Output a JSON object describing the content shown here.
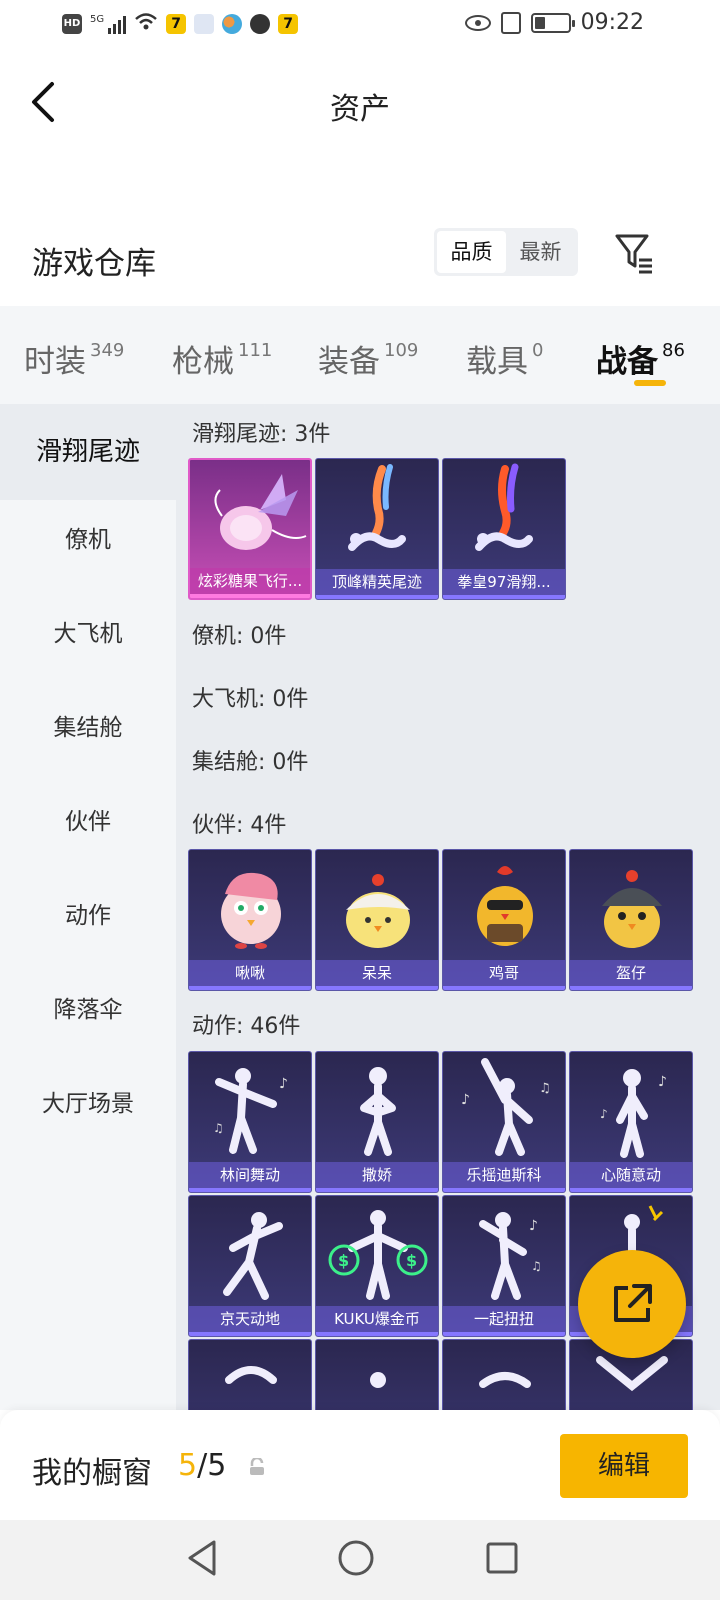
{
  "status_bar": {
    "time": "09:22",
    "signal_label": "5G",
    "hd_label": "HD",
    "app_badge": "7"
  },
  "header": {
    "title": "资产"
  },
  "warehouse": {
    "title": "游戏仓库",
    "sort_options": [
      "品质",
      "最新"
    ],
    "active_sort": "品质"
  },
  "tabs": [
    {
      "label": "时装",
      "count": "349"
    },
    {
      "label": "枪械",
      "count": "111"
    },
    {
      "label": "装备",
      "count": "109"
    },
    {
      "label": "载具",
      "count": "0"
    },
    {
      "label": "战备",
      "count": "86",
      "active": true
    }
  ],
  "sidebar": [
    "滑翔尾迹",
    "僚机",
    "大飞机",
    "集结舱",
    "伙伴",
    "动作",
    "降落伞",
    "大厅场景"
  ],
  "sections": {
    "glide": {
      "title": "滑翔尾迹: 3件",
      "items": [
        "炫彩糖果飞行...",
        "顶峰精英尾迹",
        "拳皇97滑翔..."
      ]
    },
    "wingman": {
      "title": "僚机: 0件"
    },
    "plane": {
      "title": "大飞机: 0件"
    },
    "capsule": {
      "title": "集结舱: 0件"
    },
    "partner": {
      "title": "伙伴: 4件",
      "items": [
        "啾啾",
        "呆呆",
        "鸡哥",
        "盔仔"
      ]
    },
    "action": {
      "title": "动作: 46件",
      "items": [
        "林间舞动",
        "撒娇",
        "乐摇迪斯科",
        "心随意动",
        "京天动地",
        "KUKU爆金币",
        "一起扭扭",
        "..."
      ]
    }
  },
  "showcase": {
    "title": "我的橱窗",
    "current": "5",
    "sep_total": "/5",
    "edit_label": "编辑"
  },
  "colors": {
    "accent": "#f5b40a",
    "card_bg": "#2b2750",
    "card_pink": "#c84fb6"
  }
}
